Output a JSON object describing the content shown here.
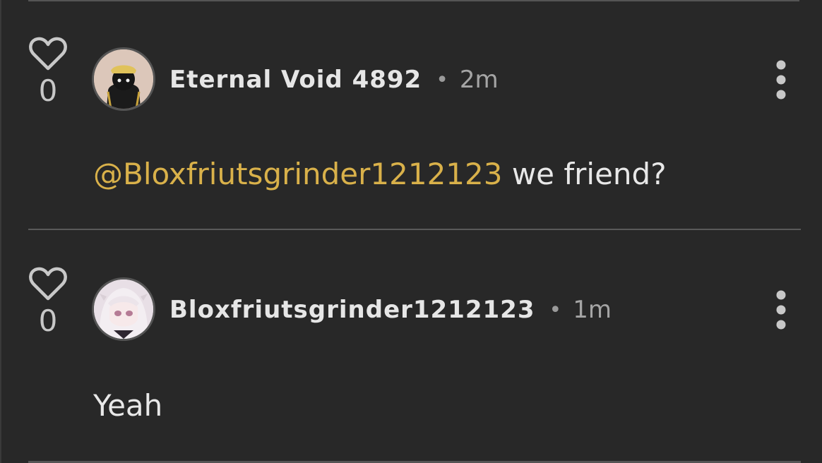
{
  "comments": [
    {
      "like_count": "0",
      "author": "Eternal Void 4892",
      "separator": "•",
      "time": "2m",
      "mention": "@Bloxfriutsgrinder1212123",
      "text": " we friend?"
    },
    {
      "like_count": "0",
      "author": "Bloxfriutsgrinder1212123",
      "separator": "•",
      "time": "1m",
      "mention": "",
      "text": "Yeah"
    }
  ],
  "icons": {
    "like": "heart-icon",
    "more": "more-vertical-icon"
  },
  "colors": {
    "background": "#282828",
    "mention": "#d9b14a",
    "text": "#e8e8e8",
    "muted": "#a5a5a5"
  }
}
